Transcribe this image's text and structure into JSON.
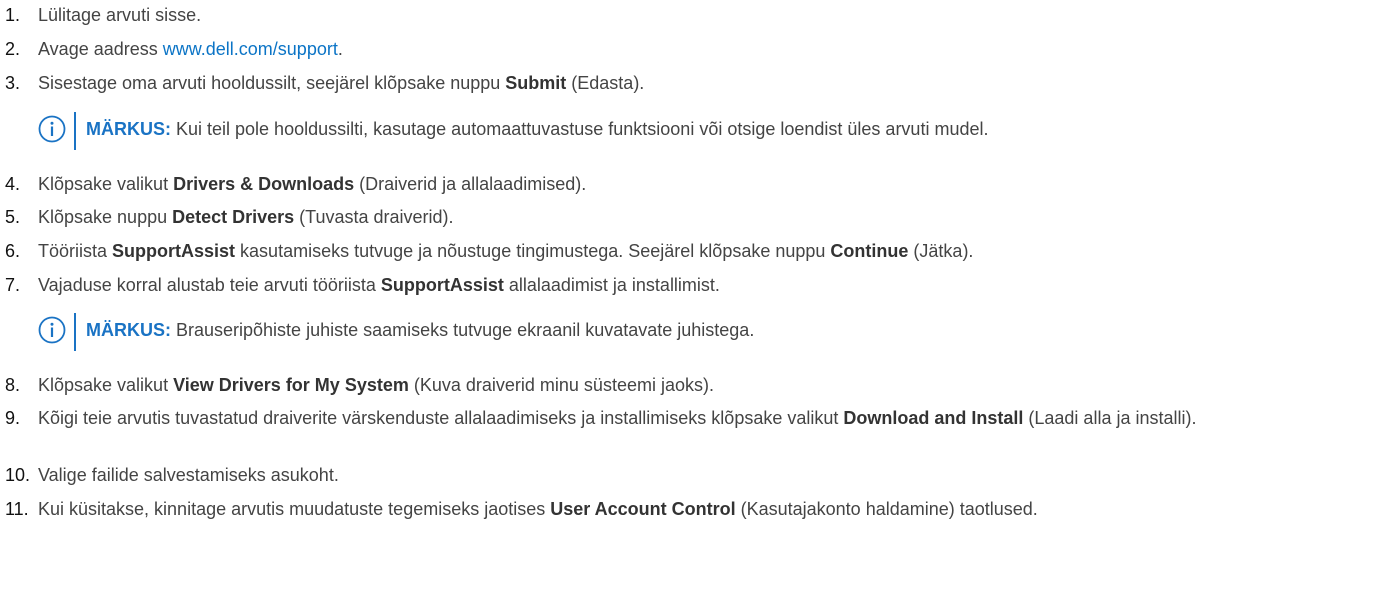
{
  "steps": [
    {
      "num": "1.",
      "text": "Lülitage arvuti sisse."
    },
    {
      "num": "2.",
      "pre": "Avage aadress ",
      "link": "www.dell.com/support",
      "post": "."
    },
    {
      "num": "3.",
      "pre": "Sisestage oma arvuti hooldussilt, seejärel klõpsake nuppu ",
      "bold": "Submit",
      "post": " (Edasta)."
    },
    {
      "num": "4.",
      "pre": "Klõpsake valikut ",
      "bold": "Drivers & Downloads",
      "post": " (Draiverid ja allalaadimised)."
    },
    {
      "num": "5.",
      "pre": "Klõpsake nuppu ",
      "bold": "Detect Drivers",
      "post": " (Tuvasta draiverid)."
    },
    {
      "num": "6.",
      "pre": "Tööriista ",
      "bold": "SupportAssist",
      "mid": " kasutamiseks tutvuge ja nõustuge tingimustega. Seejärel klõpsake nuppu ",
      "bold2": "Continue",
      "post": " (Jätka)."
    },
    {
      "num": "7.",
      "pre": "Vajaduse korral alustab teie arvuti tööriista ",
      "bold": "SupportAssist",
      "post": " allalaadimist ja installimist."
    },
    {
      "num": "8.",
      "pre": "Klõpsake valikut ",
      "bold": "View Drivers for My System",
      "post": " (Kuva draiverid minu süsteemi jaoks)."
    },
    {
      "num": "9.",
      "pre": "Kõigi teie arvutis tuvastatud draiverite värskenduste allalaadimiseks ja installimiseks klõpsake valikut ",
      "bold": "Download and Install",
      "post": " (Laadi alla ja installi)."
    },
    {
      "num": "10.",
      "text": "Valige failide salvestamiseks asukoht."
    },
    {
      "num": "11.",
      "pre": "Kui küsitakse, kinnitage arvutis muudatuste tegemiseks jaotises ",
      "bold": "User Account Control",
      "post": " (Kasutajakonto haldamine) taotlused."
    }
  ],
  "notes": [
    {
      "label": "MÄRKUS:",
      "text": " Kui teil pole hooldussilti, kasutage automaattuvastuse funktsiooni või otsige loendist üles arvuti mudel."
    },
    {
      "label": "MÄRKUS:",
      "text": " Brauseripõhiste juhiste saamiseks tutvuge ekraanil kuvatavate juhistega."
    }
  ],
  "colors": {
    "text": "#444444",
    "number": "#111111",
    "link": "#0b74c6",
    "note_accent": "#1a73c4"
  },
  "icons": {
    "note": "info-circle-icon"
  }
}
